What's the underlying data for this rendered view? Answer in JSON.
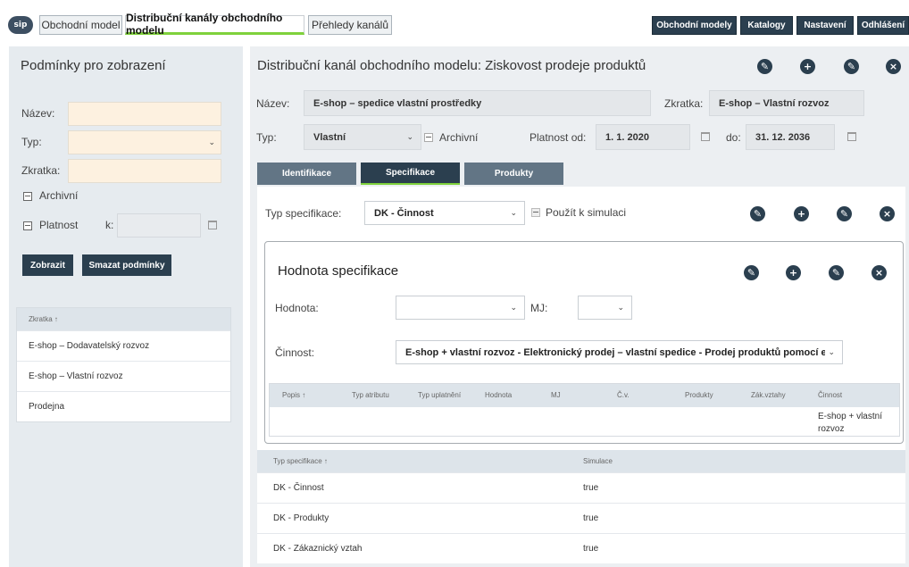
{
  "logo": {
    "text": "sip"
  },
  "nav": {
    "tabs": [
      {
        "label": "Obchodní model"
      },
      {
        "label": "Distribuční kanály obchodního modelu"
      },
      {
        "label": "Přehledy kanálů"
      }
    ],
    "right_buttons": [
      {
        "label": "Obchodní modely"
      },
      {
        "label": "Katalogy"
      },
      {
        "label": "Nastavení"
      },
      {
        "label": "Odhlášení"
      }
    ]
  },
  "filter": {
    "title": "Podmínky pro zobrazení",
    "name_label": "Název:",
    "type_label": "Typ:",
    "abbr_label": "Zkratka:",
    "archived_label": "Archivní",
    "validity_label": "Platnost",
    "validity_k_label": "k:",
    "show_button": "Zobrazit",
    "clear_button": "Smazat podmínky",
    "table": {
      "header": "Zkratka ↑",
      "rows": [
        "E-shop – Dodavatelský rozvoz",
        "E-shop – Vlastní rozvoz",
        "Prodejna"
      ]
    }
  },
  "detail": {
    "title": "Distribuční kanál obchodního modelu: Ziskovost prodeje produktů",
    "name_label": "Název:",
    "name_value": "E-shop – spedice vlastní prostředky",
    "abbr_label": "Zkratka:",
    "abbr_value": "E-shop – Vlastní rozvoz",
    "type_label": "Typ:",
    "type_value": "Vlastní",
    "archived_label": "Archivní",
    "valid_from_label": "Platnost od:",
    "valid_from_value": "1. 1. 2020",
    "valid_to_label": "do:",
    "valid_to_value": "31. 12. 2036",
    "tabs": [
      {
        "label": "Identifikace"
      },
      {
        "label": "Specifikace"
      },
      {
        "label": "Produkty"
      }
    ]
  },
  "spec": {
    "type_label": "Typ specifikace:",
    "type_value": "DK - Činnost",
    "use_sim_label": "Použít k simulaci",
    "value_panel": {
      "title": "Hodnota specifikace",
      "value_label": "Hodnota:",
      "value_value": "",
      "unit_label": "MJ:",
      "unit_value": "",
      "activity_label": "Činnost:",
      "activity_value": "E-shop + vlastní rozvoz - Elektronický prodej – vlastní spedice - Prodej produktů pomocí e-sl",
      "columns": [
        "Popis ↑",
        "Typ atributu",
        "Typ uplatnění",
        "Hodnota",
        "MJ",
        "Č.v.",
        "Produkty",
        "Zák.vztahy",
        "Činnost"
      ],
      "row_activity": "E-shop + vlastní rozvoz"
    },
    "table": {
      "columns": [
        "Typ specifikace ↑",
        "Simulace"
      ],
      "rows": [
        {
          "type": "DK - Činnost",
          "sim": "true"
        },
        {
          "type": "DK - Produkty",
          "sim": "true"
        },
        {
          "type": "DK - Zákaznický vztah",
          "sim": "true"
        }
      ]
    }
  },
  "icons": {
    "edit": "✎",
    "add": "+",
    "edit2": "✎",
    "close": "×",
    "chevron": "⌄"
  },
  "colors": {
    "accent": "#7fd13b",
    "dark": "#2b3f4f",
    "field": "#fdf1e0"
  }
}
